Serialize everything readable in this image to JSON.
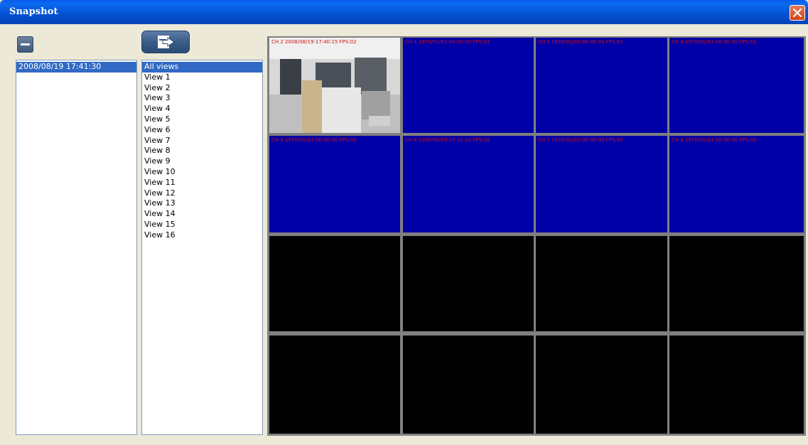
{
  "window": {
    "title": "Snapshot"
  },
  "snapshots": [
    {
      "label": "2008/08/19 17:41:30",
      "selected": true
    }
  ],
  "views": [
    {
      "label": "All views",
      "selected": true
    },
    {
      "label": "View 1"
    },
    {
      "label": "View 2"
    },
    {
      "label": "View 3"
    },
    {
      "label": "View 4"
    },
    {
      "label": "View 5"
    },
    {
      "label": "View 6"
    },
    {
      "label": "View 7"
    },
    {
      "label": "View 8"
    },
    {
      "label": "View 9"
    },
    {
      "label": "View 10"
    },
    {
      "label": "View 11"
    },
    {
      "label": "View 12"
    },
    {
      "label": "View 13"
    },
    {
      "label": "View 14"
    },
    {
      "label": "View 15"
    },
    {
      "label": "View 16"
    }
  ],
  "grid": {
    "cells": [
      {
        "type": "video",
        "osd": "CH 2 2008/08/19-17:40:15 FPS:02"
      },
      {
        "type": "blue",
        "osd": "CH 1 1970/01/01-00:00:00 FPS:02"
      },
      {
        "type": "blue",
        "osd": "CH 3 1970/01/01-00:00:00 FPS:02"
      },
      {
        "type": "blue",
        "osd": "CH 4 1970/01/01-00:00:00 FPS:01"
      },
      {
        "type": "blue",
        "osd": "CH 5 1970/01/01-00:00:00 FPS:00"
      },
      {
        "type": "blue",
        "osd": "CH 6 2008/08/19-17:31:24 FPS:00"
      },
      {
        "type": "blue",
        "osd": "CH 7 1970/01/01-00:00:00 FPS:00"
      },
      {
        "type": "blue",
        "osd": "CH 8 1970/01/01-00:00:00 FPS:00"
      },
      {
        "type": "black",
        "osd": ""
      },
      {
        "type": "black",
        "osd": ""
      },
      {
        "type": "black",
        "osd": ""
      },
      {
        "type": "black",
        "osd": ""
      },
      {
        "type": "black",
        "osd": ""
      },
      {
        "type": "black",
        "osd": ""
      },
      {
        "type": "black",
        "osd": ""
      },
      {
        "type": "black",
        "osd": ""
      }
    ]
  },
  "colors": {
    "titlebar": "#0453D4",
    "selection": "#316AC5",
    "no_signal": "#0000A6",
    "osd_text": "#D01010"
  },
  "icons": {
    "close": "close-icon",
    "remove": "minus-icon",
    "export": "export-icon"
  }
}
